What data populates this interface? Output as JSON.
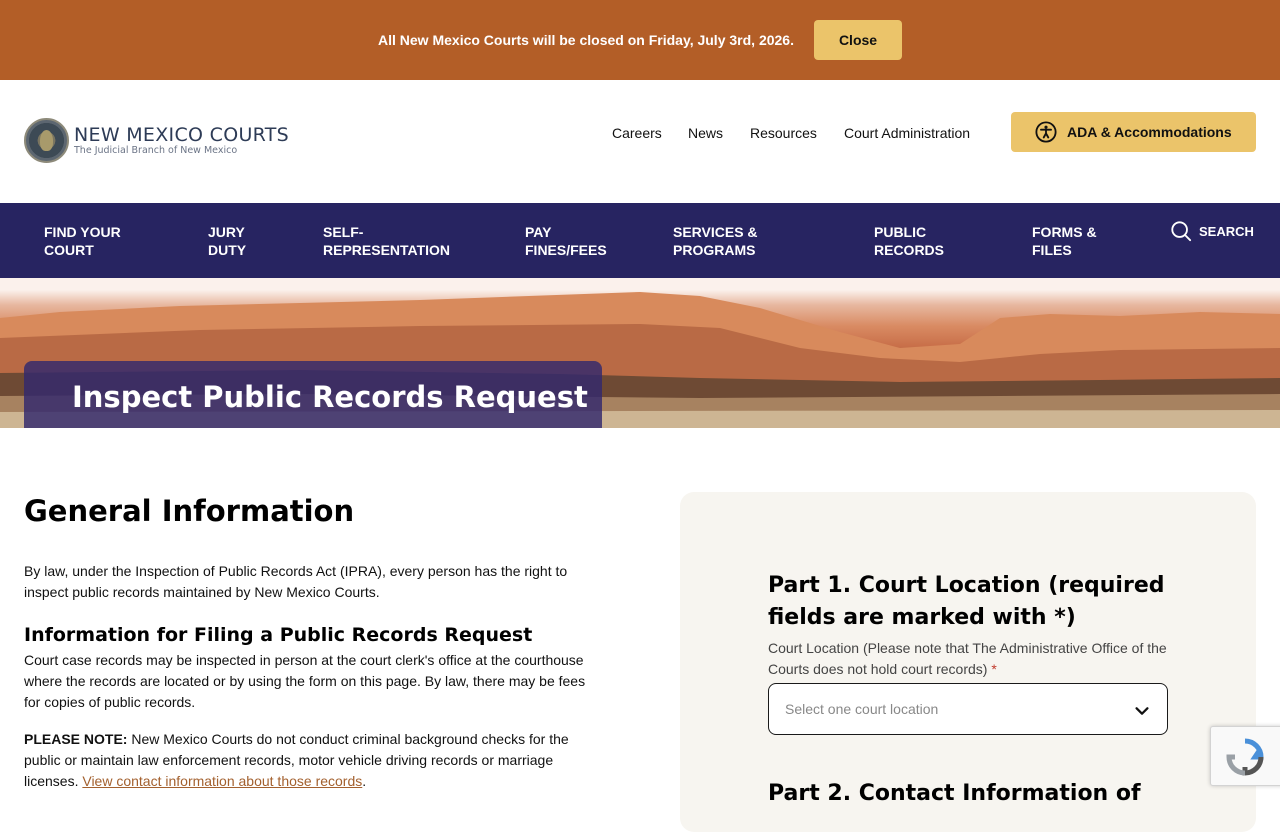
{
  "alert": {
    "message": "All New Mexico Courts will be closed on Friday, July 3rd, 2026.",
    "close_label": "Close"
  },
  "header": {
    "logo_title": "NEW MEXICO COURTS",
    "logo_subtitle": "The Judicial Branch of New Mexico",
    "utility_links": [
      "Careers",
      "News",
      "Resources",
      "Court Administration"
    ],
    "ada_label": "ADA & Accommodations"
  },
  "nav": {
    "items": [
      {
        "line1": "FIND YOUR",
        "line2": "COURT"
      },
      {
        "line1": "JURY",
        "line2": "DUTY"
      },
      {
        "line1": "SELF-",
        "line2": "REPRESENTATION"
      },
      {
        "line1": "PAY",
        "line2": "FINES/FEES"
      },
      {
        "line1": "SERVICES &",
        "line2": "PROGRAMS"
      },
      {
        "line1": "PUBLIC",
        "line2": "RECORDS"
      },
      {
        "line1": "FORMS &",
        "line2": "FILES"
      }
    ],
    "search_label": "SEARCH"
  },
  "hero": {
    "title": "Inspect Public Records Request"
  },
  "content": {
    "heading": "General Information",
    "intro": "By law, under the Inspection of Public Records Act (IPRA), every person has the right to inspect public records maintained by New Mexico Courts.",
    "subheading": "Information for Filing a Public Records Request",
    "filing_text": "Court case records may be inspected in person at the court clerk's office at the courthouse where the records are located or by using the form on this page. By law, there may be fees for copies of public records.",
    "note_label": "PLEASE NOTE:",
    "note_text": " New Mexico Courts do not conduct criminal background checks for the public or maintain law enforcement records, motor vehicle driving records or marriage licenses. ",
    "note_link": "View contact information about those records",
    "note_end": "."
  },
  "form": {
    "part1_title": "Part 1. Court Location (required fields are marked with *)",
    "location_label": "Court Location (Please note that The Administrative Office of the Courts does not hold court records)",
    "required_mark": "*",
    "location_placeholder": "Select one court location",
    "part2_title": "Part 2. Contact Information of"
  },
  "colors": {
    "alert_bg": "#b35e27",
    "accent_gold": "#ebc46a",
    "nav_bg": "#272461",
    "link": "#a3602e"
  }
}
